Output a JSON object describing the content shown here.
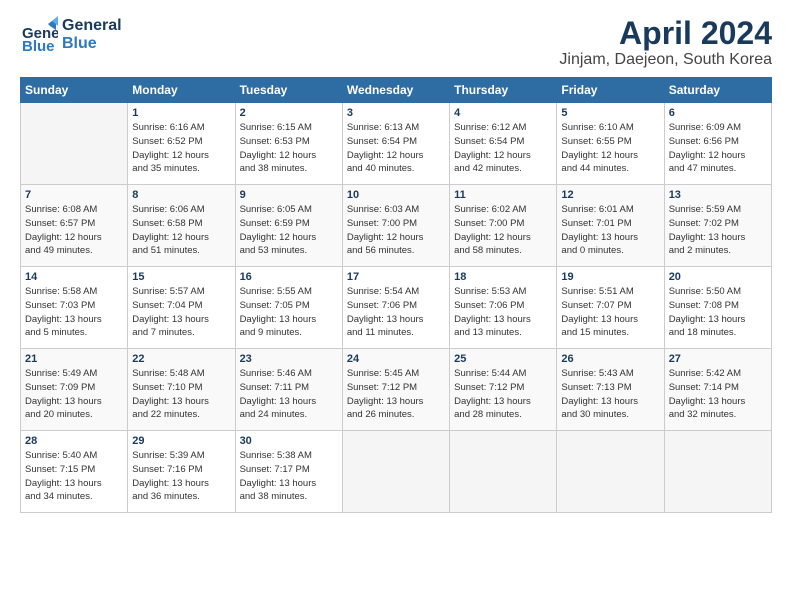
{
  "logo": {
    "line1": "General",
    "line2": "Blue"
  },
  "title": "April 2024",
  "subtitle": "Jinjam, Daejeon, South Korea",
  "headers": [
    "Sunday",
    "Monday",
    "Tuesday",
    "Wednesday",
    "Thursday",
    "Friday",
    "Saturday"
  ],
  "weeks": [
    [
      {
        "day": "",
        "info": ""
      },
      {
        "day": "1",
        "info": "Sunrise: 6:16 AM\nSunset: 6:52 PM\nDaylight: 12 hours\nand 35 minutes."
      },
      {
        "day": "2",
        "info": "Sunrise: 6:15 AM\nSunset: 6:53 PM\nDaylight: 12 hours\nand 38 minutes."
      },
      {
        "day": "3",
        "info": "Sunrise: 6:13 AM\nSunset: 6:54 PM\nDaylight: 12 hours\nand 40 minutes."
      },
      {
        "day": "4",
        "info": "Sunrise: 6:12 AM\nSunset: 6:54 PM\nDaylight: 12 hours\nand 42 minutes."
      },
      {
        "day": "5",
        "info": "Sunrise: 6:10 AM\nSunset: 6:55 PM\nDaylight: 12 hours\nand 44 minutes."
      },
      {
        "day": "6",
        "info": "Sunrise: 6:09 AM\nSunset: 6:56 PM\nDaylight: 12 hours\nand 47 minutes."
      }
    ],
    [
      {
        "day": "7",
        "info": "Sunrise: 6:08 AM\nSunset: 6:57 PM\nDaylight: 12 hours\nand 49 minutes."
      },
      {
        "day": "8",
        "info": "Sunrise: 6:06 AM\nSunset: 6:58 PM\nDaylight: 12 hours\nand 51 minutes."
      },
      {
        "day": "9",
        "info": "Sunrise: 6:05 AM\nSunset: 6:59 PM\nDaylight: 12 hours\nand 53 minutes."
      },
      {
        "day": "10",
        "info": "Sunrise: 6:03 AM\nSunset: 7:00 PM\nDaylight: 12 hours\nand 56 minutes."
      },
      {
        "day": "11",
        "info": "Sunrise: 6:02 AM\nSunset: 7:00 PM\nDaylight: 12 hours\nand 58 minutes."
      },
      {
        "day": "12",
        "info": "Sunrise: 6:01 AM\nSunset: 7:01 PM\nDaylight: 13 hours\nand 0 minutes."
      },
      {
        "day": "13",
        "info": "Sunrise: 5:59 AM\nSunset: 7:02 PM\nDaylight: 13 hours\nand 2 minutes."
      }
    ],
    [
      {
        "day": "14",
        "info": "Sunrise: 5:58 AM\nSunset: 7:03 PM\nDaylight: 13 hours\nand 5 minutes."
      },
      {
        "day": "15",
        "info": "Sunrise: 5:57 AM\nSunset: 7:04 PM\nDaylight: 13 hours\nand 7 minutes."
      },
      {
        "day": "16",
        "info": "Sunrise: 5:55 AM\nSunset: 7:05 PM\nDaylight: 13 hours\nand 9 minutes."
      },
      {
        "day": "17",
        "info": "Sunrise: 5:54 AM\nSunset: 7:06 PM\nDaylight: 13 hours\nand 11 minutes."
      },
      {
        "day": "18",
        "info": "Sunrise: 5:53 AM\nSunset: 7:06 PM\nDaylight: 13 hours\nand 13 minutes."
      },
      {
        "day": "19",
        "info": "Sunrise: 5:51 AM\nSunset: 7:07 PM\nDaylight: 13 hours\nand 15 minutes."
      },
      {
        "day": "20",
        "info": "Sunrise: 5:50 AM\nSunset: 7:08 PM\nDaylight: 13 hours\nand 18 minutes."
      }
    ],
    [
      {
        "day": "21",
        "info": "Sunrise: 5:49 AM\nSunset: 7:09 PM\nDaylight: 13 hours\nand 20 minutes."
      },
      {
        "day": "22",
        "info": "Sunrise: 5:48 AM\nSunset: 7:10 PM\nDaylight: 13 hours\nand 22 minutes."
      },
      {
        "day": "23",
        "info": "Sunrise: 5:46 AM\nSunset: 7:11 PM\nDaylight: 13 hours\nand 24 minutes."
      },
      {
        "day": "24",
        "info": "Sunrise: 5:45 AM\nSunset: 7:12 PM\nDaylight: 13 hours\nand 26 minutes."
      },
      {
        "day": "25",
        "info": "Sunrise: 5:44 AM\nSunset: 7:12 PM\nDaylight: 13 hours\nand 28 minutes."
      },
      {
        "day": "26",
        "info": "Sunrise: 5:43 AM\nSunset: 7:13 PM\nDaylight: 13 hours\nand 30 minutes."
      },
      {
        "day": "27",
        "info": "Sunrise: 5:42 AM\nSunset: 7:14 PM\nDaylight: 13 hours\nand 32 minutes."
      }
    ],
    [
      {
        "day": "28",
        "info": "Sunrise: 5:40 AM\nSunset: 7:15 PM\nDaylight: 13 hours\nand 34 minutes."
      },
      {
        "day": "29",
        "info": "Sunrise: 5:39 AM\nSunset: 7:16 PM\nDaylight: 13 hours\nand 36 minutes."
      },
      {
        "day": "30",
        "info": "Sunrise: 5:38 AM\nSunset: 7:17 PM\nDaylight: 13 hours\nand 38 minutes."
      },
      {
        "day": "",
        "info": ""
      },
      {
        "day": "",
        "info": ""
      },
      {
        "day": "",
        "info": ""
      },
      {
        "day": "",
        "info": ""
      }
    ]
  ]
}
